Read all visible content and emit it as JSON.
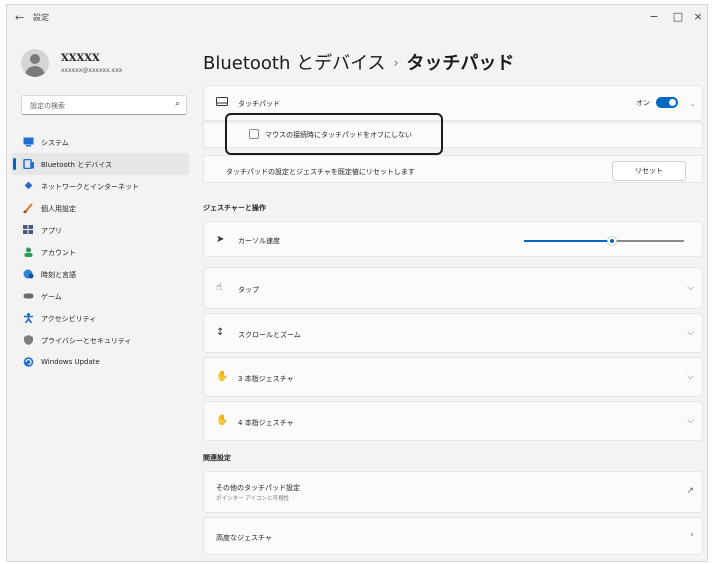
{
  "window": {
    "back_icon": "back-arrow-icon",
    "title": "設定",
    "minimize": "−",
    "maximize": "□",
    "close": "×"
  },
  "profile": {
    "name": "XXXXX",
    "email": "xxxxxx@xxxxxx.xxx"
  },
  "search": {
    "placeholder": "設定の検索",
    "icon": "search-icon"
  },
  "sidebar": {
    "items": [
      {
        "label": "システム",
        "icon": "monitor-icon",
        "color": "#1f6fd1",
        "active": false
      },
      {
        "label": "Bluetooth とデバイス",
        "icon": "devices-icon",
        "color": "#1f6fd1",
        "active": true
      },
      {
        "label": "ネットワークとインターネット",
        "icon": "wifi-icon",
        "color": "#2b62c9",
        "active": false
      },
      {
        "label": "個人用設定",
        "icon": "brush-icon",
        "color": "#d9782a",
        "active": false
      },
      {
        "label": "アプリ",
        "icon": "apps-icon",
        "color": "#4a5a7a",
        "active": false
      },
      {
        "label": "アカウント",
        "icon": "account-icon",
        "color": "#2e9b57",
        "active": false
      },
      {
        "label": "時刻と言語",
        "icon": "globe-clock-icon",
        "color": "#2c86d6",
        "active": false
      },
      {
        "label": "ゲーム",
        "icon": "gamepad-icon",
        "color": "#6b6b6b",
        "active": false
      },
      {
        "label": "アクセシビリティ",
        "icon": "accessibility-icon",
        "color": "#1b6ac9",
        "active": false
      },
      {
        "label": "プライバシーとセキュリティ",
        "icon": "shield-icon",
        "color": "#7d7d7d",
        "active": false
      },
      {
        "label": "Windows Update",
        "icon": "update-icon",
        "color": "#1f6fd1",
        "active": false
      }
    ]
  },
  "header": {
    "parent": "Bluetooth とデバイス",
    "separator": "›",
    "current": "タッチパッド"
  },
  "touchpad": {
    "label": "タッチパッド",
    "toggle_label": "オン",
    "toggle_on": true,
    "checkbox_label": "マウスの接続時にタッチパッドをオフにしない",
    "checkbox_checked": false,
    "reset_text": "タッチパッドの設定とジェスチャを既定値にリセットします",
    "reset_button": "リセット"
  },
  "gestures": {
    "heading": "ジェスチャーと操作",
    "items": [
      {
        "label": "カーソル速度",
        "icon": "cursor-icon"
      },
      {
        "label": "タップ",
        "icon": "tap-icon"
      },
      {
        "label": "スクロールとズーム",
        "icon": "scroll-icon"
      },
      {
        "label": "3 本指ジェスチャ",
        "icon": "three-finger-icon"
      },
      {
        "label": "4 本指ジェスチャ",
        "icon": "four-finger-icon"
      }
    ],
    "cursor_speed": 0.55
  },
  "related": {
    "heading": "関連設定",
    "other_label": "その他のタッチパッド設定",
    "other_sub": "ポインター アイコンと可視性",
    "advanced_label": "高度なジェスチャ"
  },
  "colors": {
    "accent": "#0067c0",
    "active_bg": "#e6e6e6"
  }
}
